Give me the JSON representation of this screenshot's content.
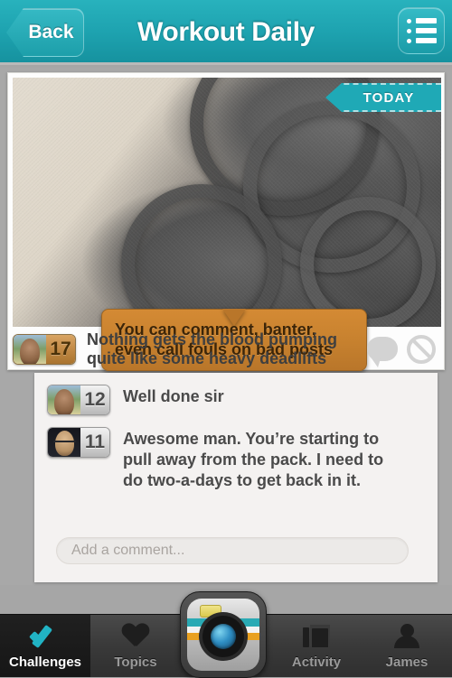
{
  "header": {
    "back_label": "Back",
    "title": "Workout Daily",
    "menu_icon": "list-menu-icon"
  },
  "post": {
    "date_badge": "TODAY",
    "tooltip": {
      "line1": "You can comment, banter,",
      "line2": "even call fouls on bad posts"
    },
    "score": "17",
    "text_line1": "Nothing gets the blood pumping",
    "text_line2": "quite like some heavy deadlifts",
    "actions": {
      "comment_icon": "comment-bubble-icon",
      "flag_icon": "block-circle-slash-icon"
    }
  },
  "comments": [
    {
      "score": "12",
      "text": "Well done sir"
    },
    {
      "score": "11",
      "text": "Awesome man. You’re starting to pull away from the pack. I need to do two-a-days to get back in it."
    }
  ],
  "comment_input": {
    "placeholder": "Add a comment..."
  },
  "tabbar": {
    "tabs": [
      {
        "label": "Challenges",
        "icon": "checkmark-icon",
        "active": true
      },
      {
        "label": "Topics",
        "icon": "heart-icon",
        "active": false
      },
      {
        "label": "Activity",
        "icon": "newspaper-icon",
        "active": false
      },
      {
        "label": "James",
        "icon": "person-icon",
        "active": false
      }
    ],
    "camera_button": "camera-icon"
  },
  "colors": {
    "teal": "#1ea3b0",
    "accent_check": "#21b3c4",
    "tooltip_orange": "#c8822f",
    "badge_gold": "#c28a46"
  }
}
